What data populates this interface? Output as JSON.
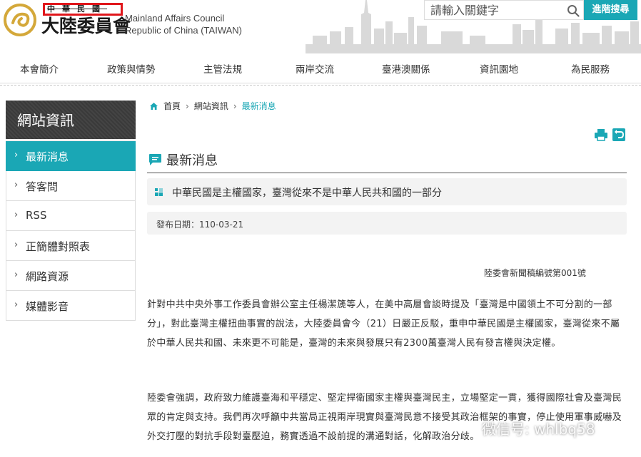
{
  "header": {
    "logo_cn_top": "中華民國",
    "logo_cn_main": "大陸委員會",
    "logo_en_line1": "Mainland Affairs Council",
    "logo_en_line2": "Republic of China (TAIWAN)",
    "search_placeholder": "請輸入關鍵字",
    "advanced_search_label": "進階搜尋"
  },
  "nav": {
    "items": [
      "本會簡介",
      "政策與情勢",
      "主管法規",
      "兩岸交流",
      "臺港澳關係",
      "資訊園地",
      "為民服務"
    ]
  },
  "sidebar": {
    "title": "網站資訊",
    "items": [
      {
        "label": "最新消息",
        "active": true
      },
      {
        "label": "答客問",
        "active": false
      },
      {
        "label": "RSS",
        "active": false
      },
      {
        "label": "正簡體對照表",
        "active": false
      },
      {
        "label": "網路資源",
        "active": false
      },
      {
        "label": "媒體影音",
        "active": false
      }
    ]
  },
  "breadcrumb": {
    "items": [
      "首頁",
      "網站資訊",
      "最新消息"
    ]
  },
  "main": {
    "section_title": "最新消息",
    "article_title": "中華民國是主權國家，臺灣從來不是中華人民共和國的一部分",
    "publish_date": "發布日期：110-03-21",
    "press_number": "陸委會新聞稿編號第001號",
    "paragraphs": [
      "針對中共中央外事工作委員會辦公室主任楊潔篪等人，在美中高層會談時提及「臺灣是中國領土不可分割的一部分」，對此臺灣主權扭曲事實的說法，大陸委員會今（21）日嚴正反駁，重申中華民國是主權國家，臺灣從來不屬於中華人民共和國、未來更不可能是，臺灣的未來與發展只有2300萬臺灣人民有發言權與決定權。",
      "陸委會強調，政府致力維護臺海和平穩定、堅定捍衛國家主權與臺灣民主，立場堅定一貫，獲得國際社會及臺灣民眾的肯定與支持。我們再次呼籲中共當局正視兩岸現實與臺灣民意不接受其政治框架的事實，停止使用軍事威嚇及外交打壓的對抗手段對臺壓迫，務實透過不設前提的溝通對話，化解政治分歧。"
    ]
  },
  "watermark": {
    "text": "微信号: whlbq58"
  },
  "colors": {
    "accent": "#1aa7b5",
    "sidebar_header": "#3e3e3e",
    "logo_gold": "#d4a83a",
    "logo_red": "#e0161b"
  }
}
